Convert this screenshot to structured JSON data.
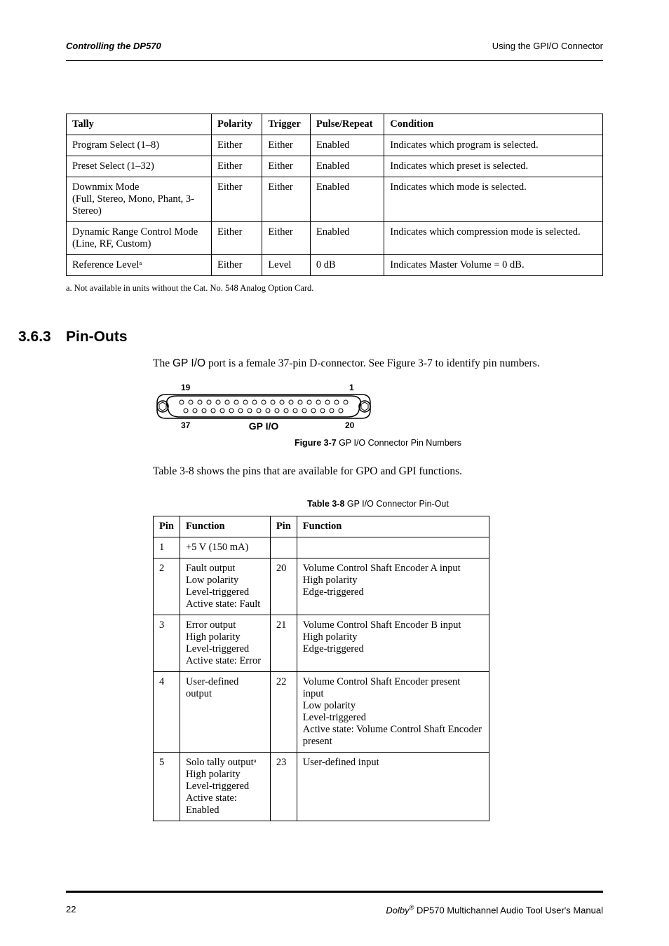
{
  "header": {
    "left": "Controlling the DP570",
    "right": "Using the GPI/O Connector"
  },
  "table1": {
    "columns": [
      "Tally",
      "Polarity",
      "Trigger",
      "Pulse/Repeat",
      "Condition"
    ],
    "rows": [
      [
        "Program Select (1–8)",
        "Either",
        "Either",
        "Enabled",
        "Indicates which program is selected."
      ],
      [
        "Preset Select (1–32)",
        "Either",
        "Either",
        "Enabled",
        "Indicates which preset is selected."
      ],
      [
        "Downmix Mode\n(Full, Stereo, Mono, Phant, 3-Stereo)",
        "Either",
        "Either",
        "Enabled",
        "Indicates which mode is selected."
      ],
      [
        "Dynamic Range Control Mode\n(Line, RF, Custom)",
        "Either",
        "Either",
        "Enabled",
        "Indicates which compression mode is selected."
      ],
      [
        "Reference Levelᵃ",
        "Either",
        "Level",
        "0 dB",
        "Indicates Master Volume = 0 dB."
      ]
    ],
    "footnote": "a. Not available in units without the Cat. No. 548 Analog Option Card."
  },
  "section": {
    "number": "3.6.3",
    "title": "Pin-Outs",
    "para1_a": "The ",
    "para1_b": "GP I/O",
    "para1_c": " port is a female 37-pin D-connector. See Figure 3-7 to identify pin numbers."
  },
  "connector": {
    "top_left": "19",
    "top_right": "1",
    "bottom_left": "37",
    "bottom_right": "20",
    "label": "GP I/O"
  },
  "figure_caption": {
    "bold": "Figure 3-7",
    "rest": " GP I/O Connector Pin Numbers"
  },
  "para2": "Table 3-8 shows the pins that are available for GPO and GPI functions.",
  "table2": {
    "caption_bold": "Table 3-8",
    "caption_rest": " GP I/O Connector Pin-Out",
    "columns": [
      "Pin",
      "Function",
      "Pin",
      "Function"
    ],
    "rows": [
      {
        "p1": "1",
        "f1": "+5 V (150 mA)",
        "p2": "",
        "f2": ""
      },
      {
        "p1": "2",
        "f1": "Fault output\nLow polarity\nLevel-triggered\nActive state: Fault",
        "p2": "20",
        "f2": "Volume Control Shaft Encoder A input\nHigh polarity\nEdge-triggered"
      },
      {
        "p1": "3",
        "f1": "Error output\nHigh polarity\nLevel-triggered\nActive state: Error",
        "p2": "21",
        "f2": "Volume Control Shaft Encoder B input\nHigh polarity\nEdge-triggered"
      },
      {
        "p1": "4",
        "f1": "User-defined output",
        "p2": "22",
        "f2": "Volume Control Shaft Encoder present input\nLow polarity\nLevel-triggered\nActive state: Volume Control Shaft Encoder present"
      },
      {
        "p1": "5",
        "f1": "Solo tally outputᵃ\nHigh polarity\nLevel-triggered\nActive state: Enabled",
        "p2": "23",
        "f2": "User-defined input"
      }
    ]
  },
  "footer": {
    "page": "22",
    "right_prefix": "Dolby",
    "right_sup": "®",
    "right_rest": " DP570 Multichannel Audio Tool User's Manual"
  }
}
